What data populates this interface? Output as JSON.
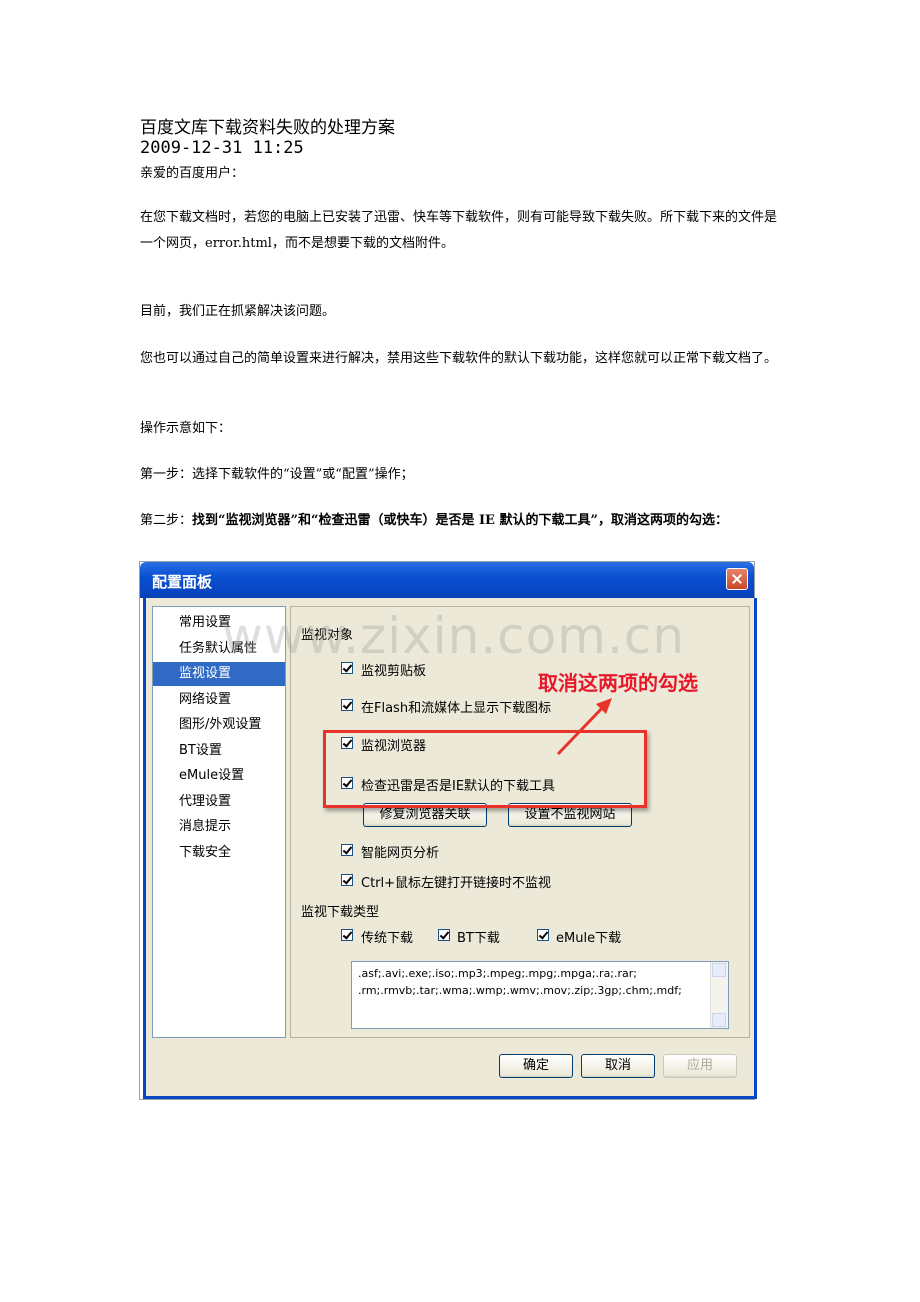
{
  "doc": {
    "title": "百度文库下载资料失败的处理方案",
    "date": "2009-12-31 11:25",
    "greeting": "亲爱的百度用户：",
    "para1": "在您下载文档时，若您的电脑上已安装了迅雷、快车等下载软件，则有可能导致下载失败。所下载下来的文件是一个网页，error.html，而不是想要下载的文档附件。",
    "para2": "目前，我们正在抓紧解决该问题。",
    "para3": "您也可以通过自己的简单设置来进行解决，禁用这些下载软件的默认下载功能，这样您就可以正常下载文档了。",
    "para4": "操作示意如下：",
    "step1": "第一步：选择下载软件的“设置”或“配置”操作；",
    "step2_prefix": "第二步：",
    "step2_bold": "找到“监视浏览器”和“检查迅雷（或快车）是否是 IE 默认的下载工具”，取消这两项的勾选："
  },
  "dialog": {
    "title": "配置面板",
    "nav": [
      "常用设置",
      "任务默认属性",
      "监视设置",
      "网络设置",
      "图形/外观设置",
      "BT设置",
      "eMule设置",
      "代理设置",
      "消息提示",
      "下载安全"
    ],
    "selected_nav_index": 2,
    "section_monitor": "监视对象",
    "options": [
      "监视剪贴板",
      "在Flash和流媒体上显示下载图标",
      "监视浏览器",
      "检查迅雷是否是IE默认的下载工具"
    ],
    "btn_repair": "修复浏览器关联",
    "btn_no_monitor": "设置不监视网站",
    "opt_smart": "智能网页分析",
    "opt_ctrl": "Ctrl+鼠标左键打开链接时不监视",
    "section_types": "监视下载类型",
    "types": [
      "传统下载",
      "BT下载",
      "eMule下载"
    ],
    "extensions_line1": ".asf;.avi;.exe;.iso;.mp3;.mpeg;.mpg;.mpga;.ra;.rar;",
    "extensions_line2": ".rm;.rmvb;.tar;.wma;.wmp;.wmv;.mov;.zip;.3gp;.chm;.mdf;",
    "btn_ok": "确定",
    "btn_cancel": "取消",
    "btn_apply": "应用",
    "annotation": "取消这两项的勾选",
    "watermark": "www.zixin.com.cn",
    "colors": {
      "titlebar": "#0a50d0",
      "selection": "#316ac5",
      "annotation": "#e8182a"
    }
  }
}
